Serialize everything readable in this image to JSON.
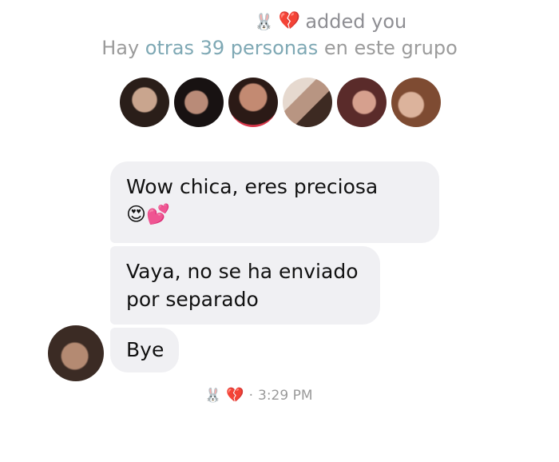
{
  "header": {
    "bunny_icon": "🐰",
    "heart_icon": "💔",
    "added_text": "added you"
  },
  "group_info": {
    "prefix": "Hay ",
    "link_text": "otras 39 personas",
    "suffix": " en este grupo"
  },
  "members": [
    {
      "name": "member-avatar-1"
    },
    {
      "name": "member-avatar-2"
    },
    {
      "name": "member-avatar-3"
    },
    {
      "name": "member-avatar-4"
    },
    {
      "name": "member-avatar-5"
    },
    {
      "name": "member-avatar-6"
    }
  ],
  "messages": [
    {
      "line1": "Wow chica, eres preciosa",
      "emoji": "😍💕"
    },
    {
      "line1": "Vaya, no se ha enviado",
      "line2": "por separado"
    },
    {
      "line1": "Bye"
    }
  ],
  "receipt": {
    "bunny_icon": "🐰",
    "heart_icon": "💔",
    "separator": "·",
    "time": "3:29 PM"
  },
  "colors": {
    "link": "#7ea8b4",
    "bubble": "#f0f0f3",
    "muted": "#9b9b9b"
  }
}
